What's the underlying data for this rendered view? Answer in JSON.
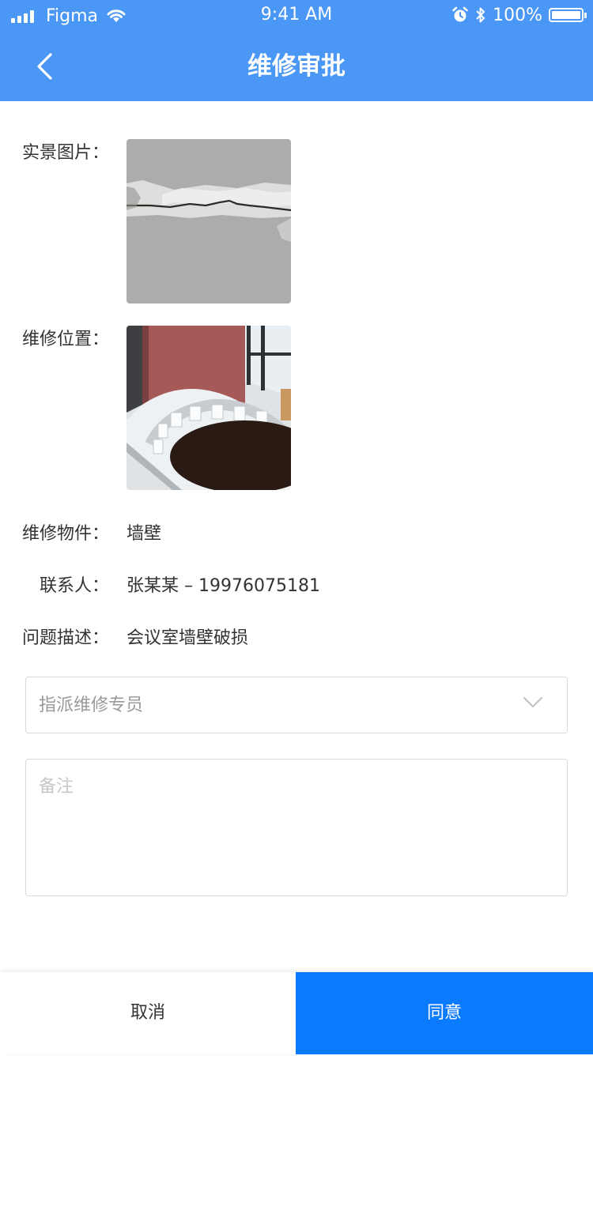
{
  "status_bar": {
    "carrier": "Figma",
    "time": "9:41 AM",
    "battery_text": "100%",
    "battery_level": 1.0,
    "icons": [
      "signal-icon",
      "wifi-icon",
      "alarm-icon",
      "bluetooth-icon",
      "battery-icon"
    ]
  },
  "nav": {
    "title": "维修审批",
    "back_icon": "back-chevron-icon"
  },
  "details": {
    "photo_label": "实景图片：",
    "location_label": "维修位置：",
    "item_label": "维修物件：",
    "item_value": "墙壁",
    "contact_label": "联系人：",
    "contact_value": "张某某 – 19976075181",
    "problem_label": "问题描述：",
    "problem_value": "会议室墙壁破损"
  },
  "form": {
    "assign_placeholder": "指派维修专员",
    "remark_placeholder": "备注"
  },
  "actions": {
    "cancel_label": "取消",
    "agree_label": "同意"
  },
  "colors": {
    "header": "#4a97f5",
    "primary_button": "#0a7afe",
    "placeholder": "#999999",
    "border": "#d9d9d9"
  }
}
